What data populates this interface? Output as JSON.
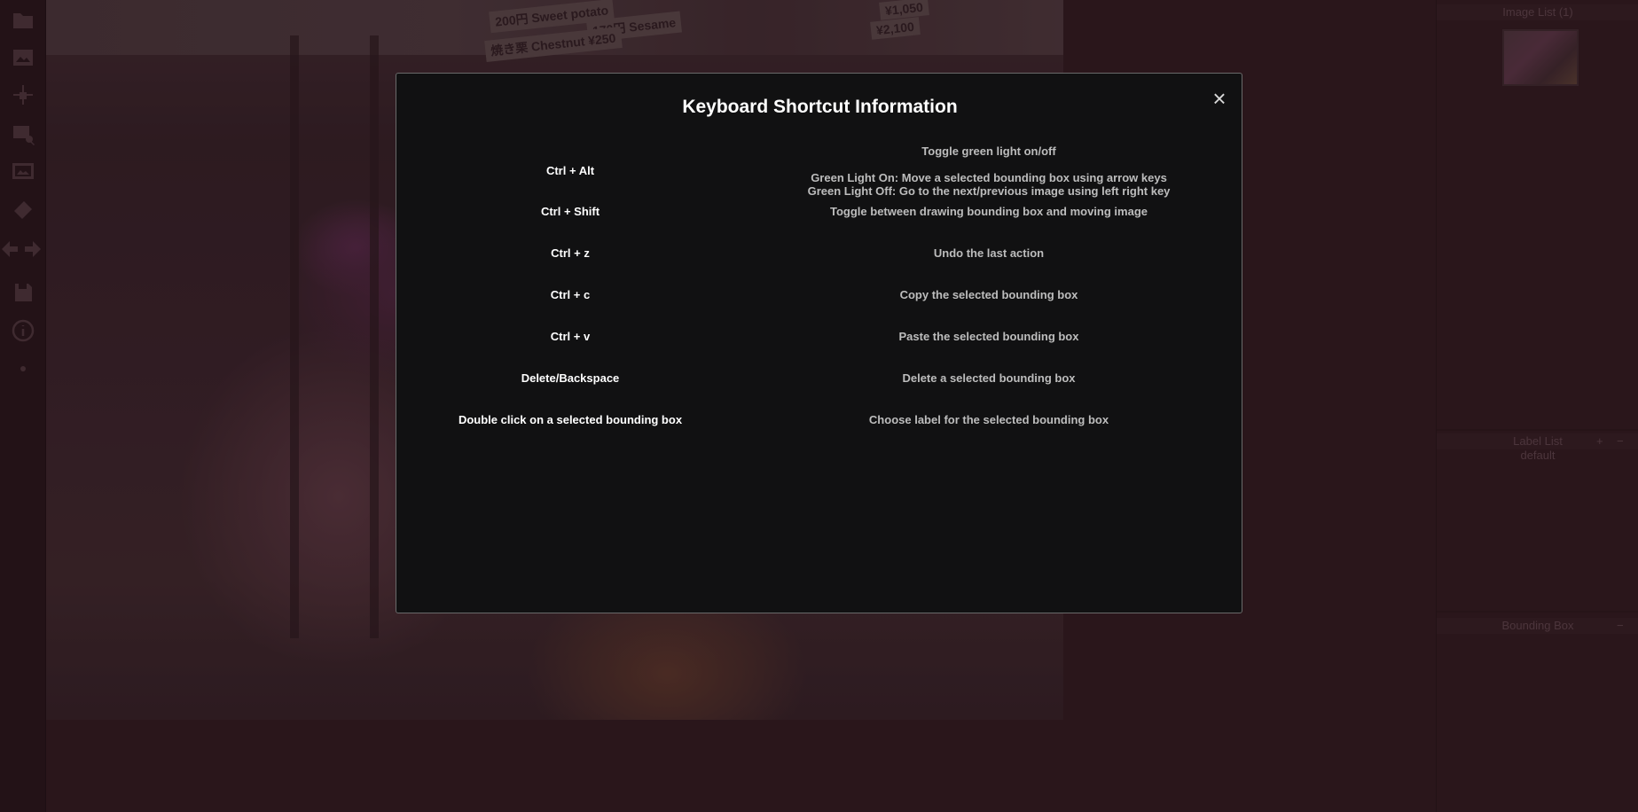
{
  "toolbar": {
    "tools": [
      {
        "icon": "folder-icon"
      },
      {
        "icon": "image-icon"
      },
      {
        "icon": "crosshair-move-icon"
      },
      {
        "icon": "image-search-icon"
      },
      {
        "icon": "image-frame-icon"
      },
      {
        "icon": "eraser-icon"
      },
      {
        "icon": "prev-arrow-icon"
      },
      {
        "icon": "next-arrow-icon"
      },
      {
        "icon": "save-icon"
      },
      {
        "icon": "info-icon"
      },
      {
        "icon": "green-light-indicator-icon"
      }
    ]
  },
  "image_signs": {
    "sign1": "200円 Sweet potato",
    "sign2": "170円 Sesame",
    "sign3": "焼き栗 Chestnut ¥250",
    "sign4": "¥2,100",
    "sign5": "¥1,050"
  },
  "right_panel": {
    "image_list_title": "Image List (1)",
    "label_list_title": "Label List",
    "label_list_add": "+",
    "label_list_remove": "−",
    "label_default": "default",
    "bounding_box_title": "Bounding Box",
    "bounding_box_collapse": "−"
  },
  "modal": {
    "title": "Keyboard Shortcut Information",
    "close_label": "×",
    "shortcuts": [
      {
        "key": "Ctrl + Alt",
        "desc_lines": [
          "Toggle green light on/off",
          "",
          "Green Light On: Move a selected bounding box using arrow keys",
          "Green Light Off: Go to the next/previous image using left right key"
        ]
      },
      {
        "key": "Ctrl + Shift",
        "desc_lines": [
          "Toggle between drawing bounding box and moving image"
        ]
      },
      {
        "key": "Ctrl + z",
        "desc_lines": [
          "Undo the last action"
        ]
      },
      {
        "key": "Ctrl + c",
        "desc_lines": [
          "Copy the selected bounding box"
        ]
      },
      {
        "key": "Ctrl + v",
        "desc_lines": [
          "Paste the selected bounding box"
        ]
      },
      {
        "key": "Delete/Backspace",
        "desc_lines": [
          "Delete a selected bounding box"
        ]
      },
      {
        "key": "Double click on a selected bounding box",
        "desc_lines": [
          "Choose label for the selected bounding box"
        ]
      }
    ]
  },
  "colors": {
    "modal_bg": "#111112",
    "overlay_tint": "#2a0e16",
    "key_text": "#ffffff",
    "desc_text": "#bdbdbd"
  }
}
